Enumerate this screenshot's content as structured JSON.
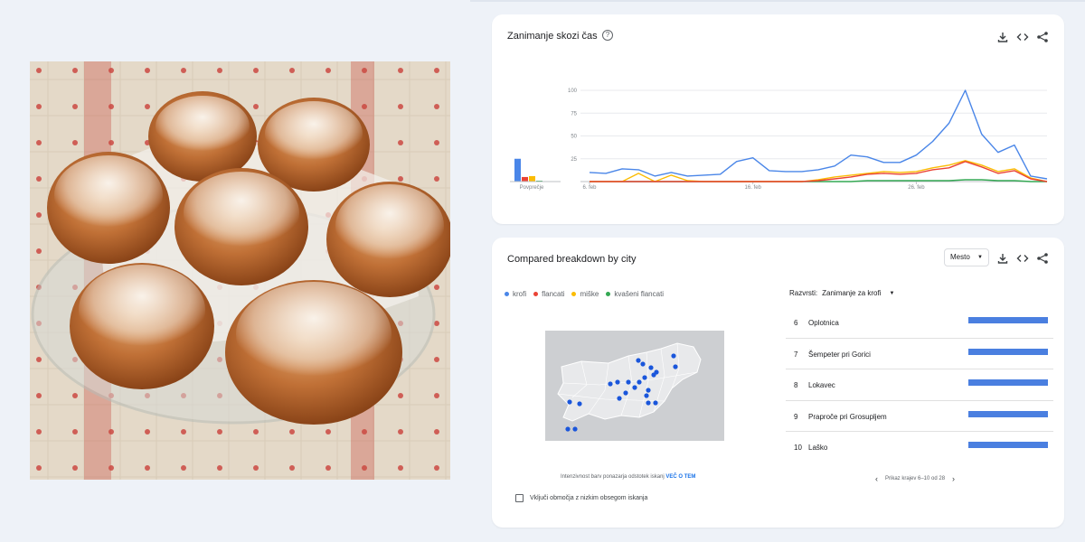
{
  "interest_card": {
    "title": "Zanimanje skozi čas",
    "help_icon": "?",
    "tools": [
      "download-icon",
      "embed-icon",
      "share-icon"
    ],
    "average_label": "Povprečje",
    "colors": {
      "krofi": "#4a86e8",
      "flancati": "#ea4335",
      "miske": "#fbbc04",
      "kvaseni_flancati": "#34a853"
    }
  },
  "chart_data": {
    "type": "line",
    "title": "Zanimanje skozi čas",
    "xlabel": "",
    "ylabel": "",
    "ylim": [
      0,
      100
    ],
    "y_ticks": [
      "100",
      "75",
      "50",
      "25"
    ],
    "x_ticks": [
      "6. feb",
      "16. feb",
      "26. feb"
    ],
    "x": [
      1,
      2,
      3,
      4,
      5,
      6,
      7,
      8,
      9,
      10,
      11,
      12,
      13,
      14,
      15,
      16,
      17,
      18,
      19,
      20,
      21,
      22,
      23,
      24,
      25,
      26,
      27,
      28,
      29
    ],
    "series": [
      {
        "name": "krofi",
        "color": "#4a86e8",
        "values": [
          10,
          9,
          14,
          13,
          6,
          10,
          6,
          7,
          8,
          22,
          26,
          12,
          11,
          11,
          13,
          17,
          29,
          27,
          21,
          21,
          29,
          44,
          64,
          100,
          52,
          32,
          40,
          6,
          3
        ]
      },
      {
        "name": "flancati",
        "color": "#ea4335",
        "values": [
          0,
          0,
          0,
          0,
          0,
          0,
          0,
          0,
          0,
          0,
          0,
          0,
          0,
          0,
          1,
          3,
          5,
          8,
          9,
          8,
          9,
          13,
          15,
          22,
          16,
          9,
          12,
          3,
          0
        ]
      },
      {
        "name": "miške",
        "color": "#fbbc04",
        "values": [
          0,
          0,
          0,
          9,
          0,
          7,
          1,
          0,
          0,
          0,
          0,
          0,
          0,
          0,
          2,
          5,
          7,
          9,
          11,
          10,
          11,
          15,
          18,
          23,
          18,
          11,
          14,
          4,
          0
        ]
      },
      {
        "name": "kvašeni flancati",
        "color": "#34a853",
        "values": [
          0,
          0,
          0,
          0,
          0,
          0,
          0,
          0,
          0,
          0,
          0,
          0,
          0,
          0,
          0,
          0,
          0,
          1,
          1,
          1,
          1,
          1,
          1,
          2,
          2,
          1,
          1,
          0,
          0
        ]
      }
    ],
    "averages": [
      {
        "name": "krofi",
        "color": "#4a86e8",
        "value": 25
      },
      {
        "name": "flancati",
        "color": "#ea4335",
        "value": 5
      },
      {
        "name": "miške",
        "color": "#fbbc04",
        "value": 6
      },
      {
        "name": "kvašeni flancati",
        "color": "#34a853",
        "value": 1
      }
    ]
  },
  "breakdown_card": {
    "title": "Compared breakdown by city",
    "select_value": "Mesto",
    "legend": [
      {
        "label": "krofi",
        "color": "#4a86e8"
      },
      {
        "label": "flancati",
        "color": "#ea4335"
      },
      {
        "label": "miške",
        "color": "#fbbc04"
      },
      {
        "label": "kvašeni flancati",
        "color": "#34a853"
      }
    ],
    "sort_label": "Razvrsti:",
    "sort_value": "Zanimanje za krofi",
    "map_note": "Intenzivnost barv ponazarja odstotek iskanj",
    "map_note_link": "VEČ O TEM",
    "checkbox_label": "Vključi območja z nizkim obsegom iskanja",
    "pager_text": "Prikaz krajev 6–10 od 28",
    "rankings": [
      {
        "num": "6",
        "name": "Oplotnica",
        "value": 100
      },
      {
        "num": "7",
        "name": "Šempeter pri Gorici",
        "value": 100
      },
      {
        "num": "8",
        "name": "Lokavec",
        "value": 100
      },
      {
        "num": "9",
        "name": "Praproče pri Grosupljem",
        "value": 100
      },
      {
        "num": "10",
        "name": "Laško",
        "value": 100
      }
    ]
  }
}
